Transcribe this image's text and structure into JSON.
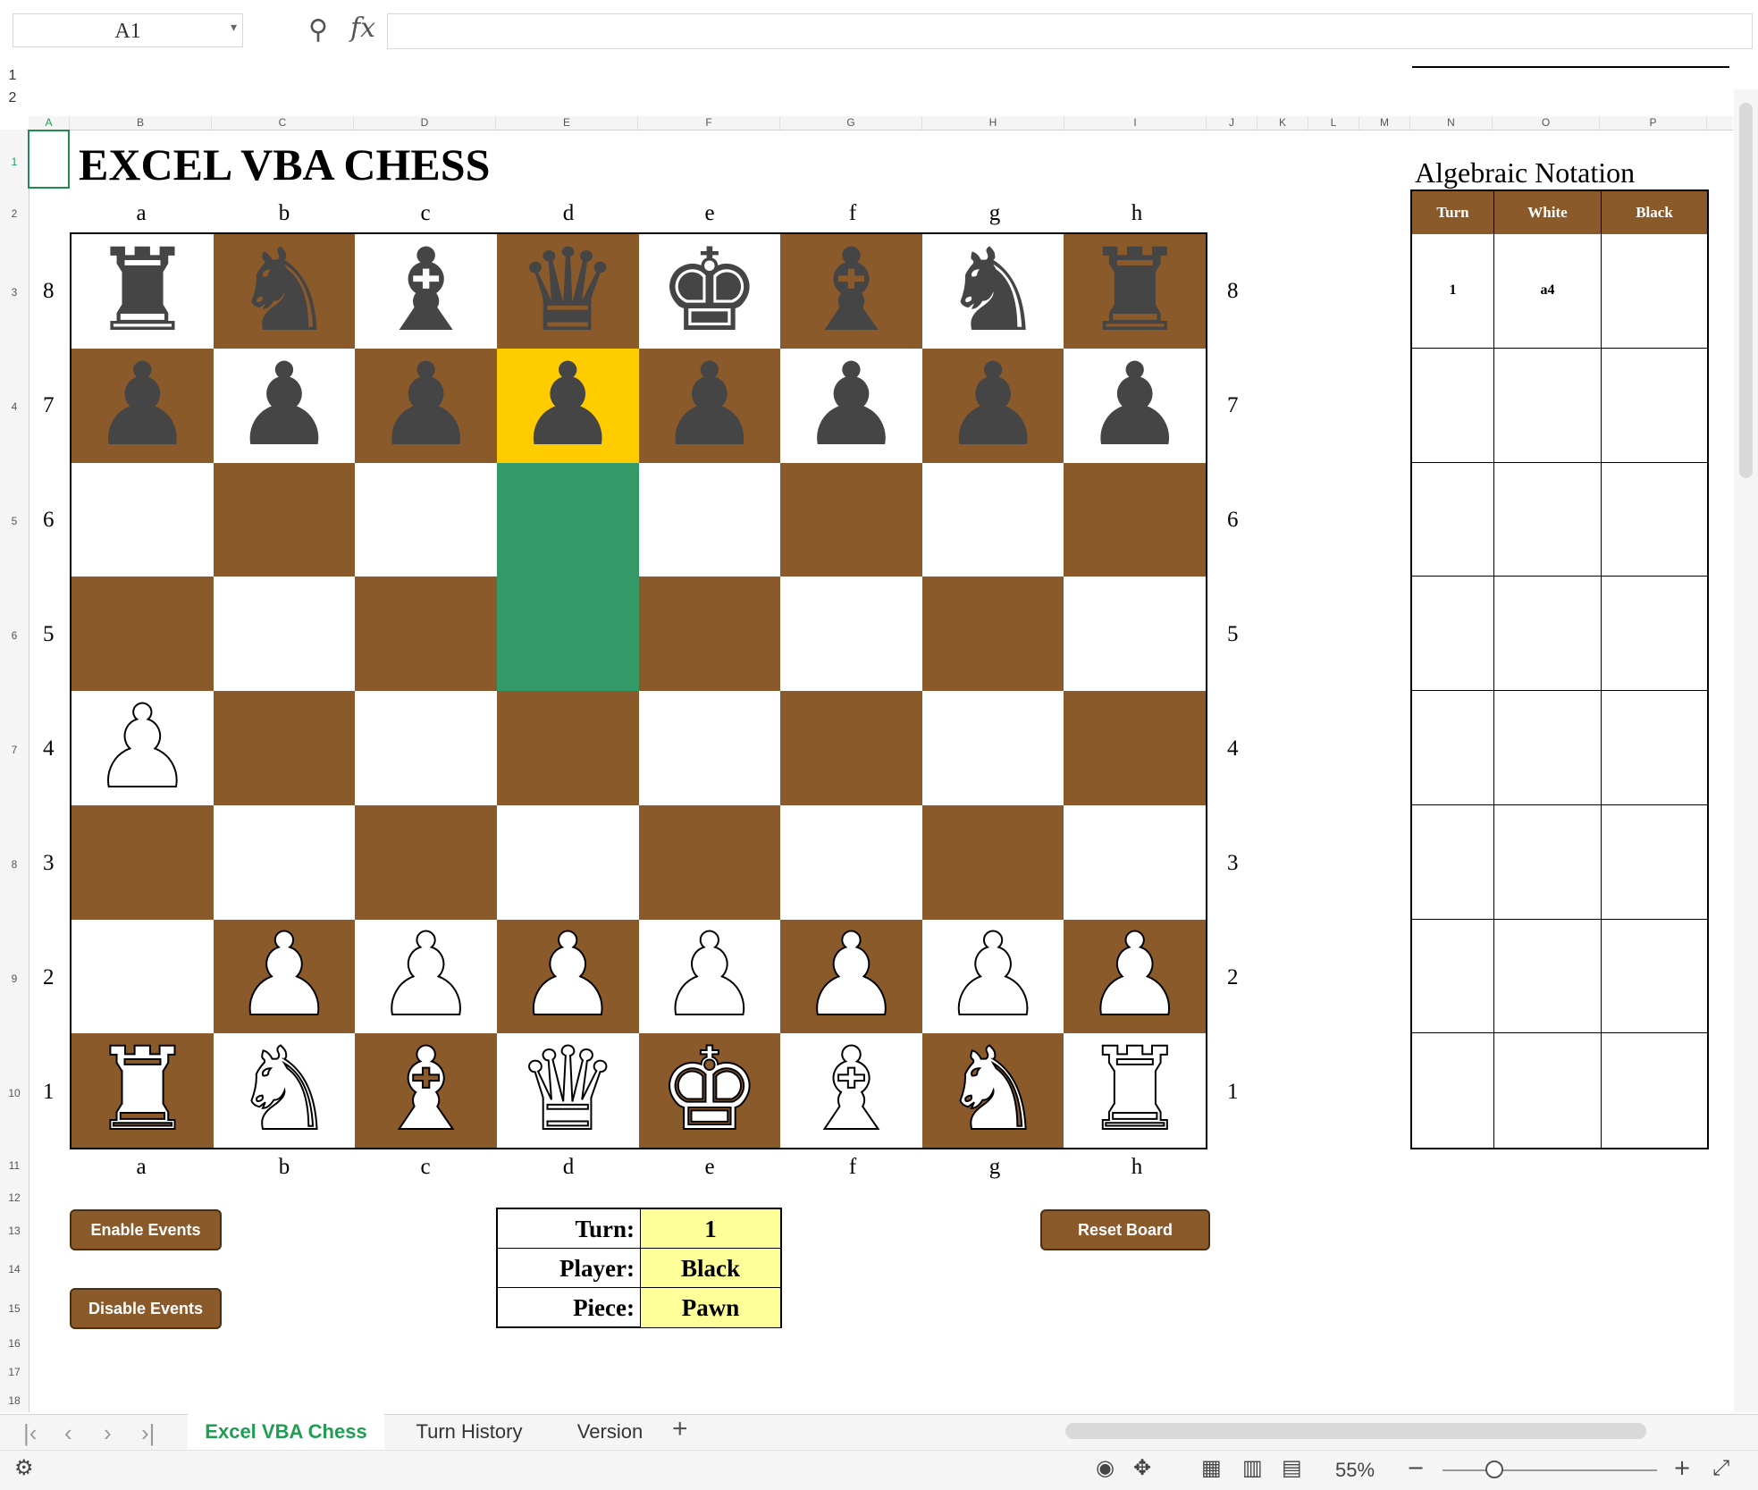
{
  "formula_bar": {
    "name_box": "A1",
    "formula": ""
  },
  "group_levels": [
    "1",
    "2"
  ],
  "columns": [
    "A",
    "B",
    "C",
    "D",
    "E",
    "F",
    "G",
    "H",
    "I",
    "J",
    "K",
    "L",
    "M",
    "N",
    "O",
    "P"
  ],
  "rows": [
    "1",
    "2",
    "3",
    "4",
    "5",
    "6",
    "7",
    "8",
    "9",
    "10",
    "11",
    "12",
    "13",
    "14",
    "15",
    "16",
    "17",
    "18"
  ],
  "title": "EXCEL VBA CHESS",
  "files": [
    "a",
    "b",
    "c",
    "d",
    "e",
    "f",
    "g",
    "h"
  ],
  "ranks": [
    "8",
    "7",
    "6",
    "5",
    "4",
    "3",
    "2",
    "1"
  ],
  "board": [
    [
      "br",
      "bn",
      "bb",
      "bq",
      "bk",
      "bb",
      "bn",
      "br"
    ],
    [
      "bp",
      "bp",
      "bp",
      "bp",
      "bp",
      "bp",
      "bp",
      "bp"
    ],
    [
      "",
      "",
      "",
      "",
      "",
      "",
      "",
      ""
    ],
    [
      "",
      "",
      "",
      "",
      "",
      "",
      "",
      ""
    ],
    [
      "wp",
      "",
      "",
      "",
      "",
      "",
      "",
      ""
    ],
    [
      "",
      "",
      "",
      "",
      "",
      "",
      "",
      ""
    ],
    [
      "",
      "wp",
      "wp",
      "wp",
      "wp",
      "wp",
      "wp",
      "wp"
    ],
    [
      "wr",
      "wn",
      "wb",
      "wq",
      "wk",
      "wb",
      "wn",
      "wr"
    ]
  ],
  "highlights": {
    "selected": [
      "d7"
    ],
    "targets": [
      "d6",
      "d5"
    ],
    "selected_color": "#ffcc00",
    "target_color": "#339966"
  },
  "colors": {
    "dark_square": "#8b5a2b",
    "light_square": "#ffffff",
    "accent": "#1e9e50"
  },
  "notation": {
    "title": "Algebraic Notation",
    "headers": [
      "Turn",
      "White",
      "Black"
    ],
    "moves": [
      {
        "turn": "1",
        "white": "a4",
        "black": ""
      }
    ]
  },
  "buttons": {
    "enable": "Enable Events",
    "disable": "Disable Events",
    "reset": "Reset Board"
  },
  "status": {
    "turn_label": "Turn:",
    "turn_value": "1",
    "player_label": "Player:",
    "player_value": "Black",
    "piece_label": "Piece:",
    "piece_value": "Pawn"
  },
  "sheet_tabs": [
    "Excel VBA Chess",
    "Turn History",
    "Version"
  ],
  "active_tab": "Excel VBA Chess",
  "zoom": "55%"
}
